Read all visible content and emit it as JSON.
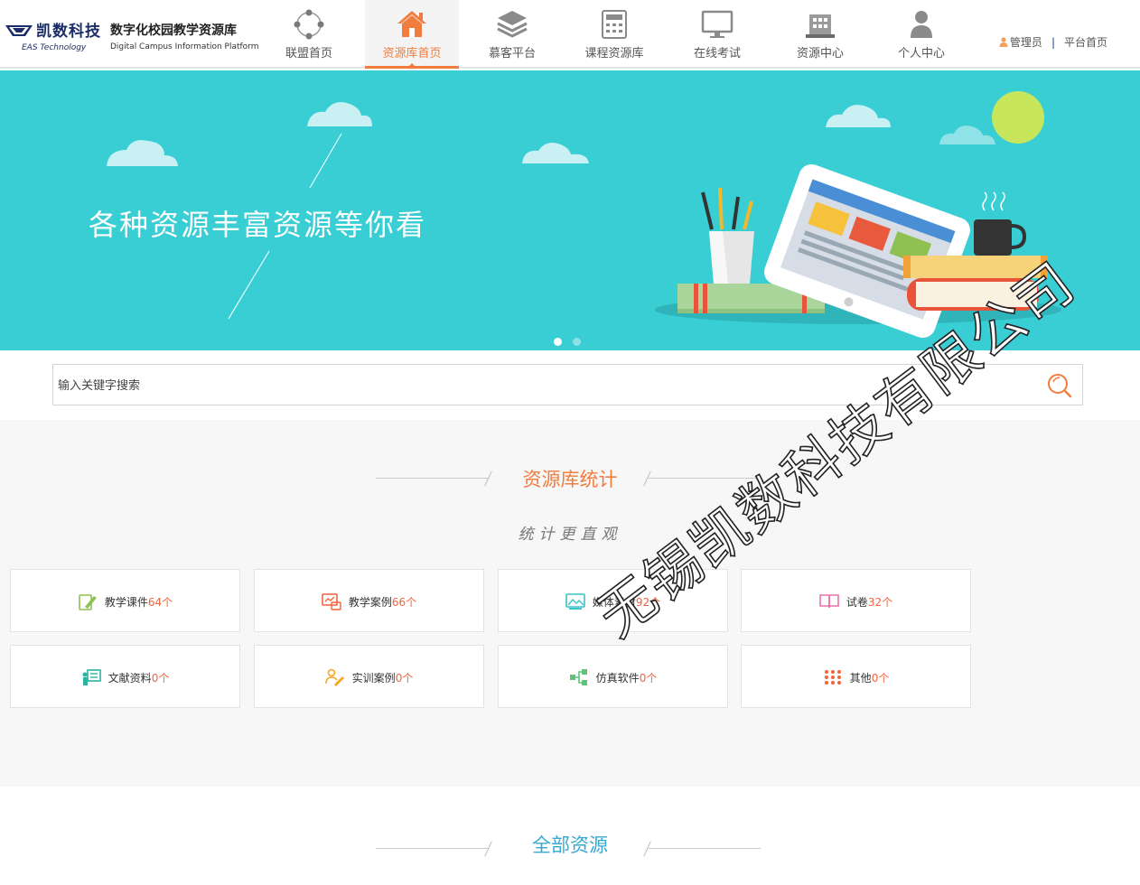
{
  "logo": {
    "brand": "凯数科技",
    "name_cn": "数字化校园教学资源库",
    "brand_en": "EAS Technology",
    "name_en": "Digital Campus Information Platform"
  },
  "nav": {
    "items": [
      {
        "label": "联盟首页",
        "icon": "network-circle-icon"
      },
      {
        "label": "资源库首页",
        "icon": "home-icon",
        "active": true
      },
      {
        "label": "慕客平台",
        "icon": "layers-stack-icon"
      },
      {
        "label": "课程资源库",
        "icon": "calculator-icon"
      },
      {
        "label": "在线考试",
        "icon": "monitor-icon"
      },
      {
        "label": "资源中心",
        "icon": "building-icon"
      },
      {
        "label": "个人中心",
        "icon": "person-icon"
      }
    ]
  },
  "user": {
    "admin_label": "管理员",
    "separator": "|",
    "platform_link": "平台首页"
  },
  "banner": {
    "slogan": "各种资源丰富资源等你看",
    "slides": 2,
    "active_slide": 1
  },
  "search": {
    "placeholder": "输入关键字搜索"
  },
  "stats": {
    "title": "资源库统计",
    "subtitle": "统计更直观",
    "cards": [
      {
        "label": "教学课件",
        "count": "64个",
        "icon": "courseware-icon",
        "color": "#8cc152"
      },
      {
        "label": "教学案例",
        "count": "66个",
        "icon": "case-icon",
        "color": "#f0643c"
      },
      {
        "label": "媒体素材",
        "count": "92个",
        "icon": "media-icon",
        "color": "#3bc3c9"
      },
      {
        "label": "试卷",
        "count": "32个",
        "icon": "exam-book-icon",
        "color": "#ee6ea8"
      },
      {
        "label": "文献资料",
        "count": "0个",
        "icon": "literature-icon",
        "color": "#2bb3a4"
      },
      {
        "label": "实训案例",
        "count": "0个",
        "icon": "training-icon",
        "color": "#f5a623"
      },
      {
        "label": "仿真软件",
        "count": "0个",
        "icon": "simulation-icon",
        "color": "#62c27c"
      },
      {
        "label": "其他",
        "count": "0个",
        "icon": "grid-dots-icon",
        "color": "#f0643c"
      }
    ]
  },
  "all_resources": {
    "title": "全部资源"
  },
  "watermark": "无锡凯数科技有限公司",
  "colors": {
    "accent": "#f07c3e",
    "banner_bg": "#38ced4",
    "count": "#f0643c",
    "all_title": "#38a7d2"
  }
}
